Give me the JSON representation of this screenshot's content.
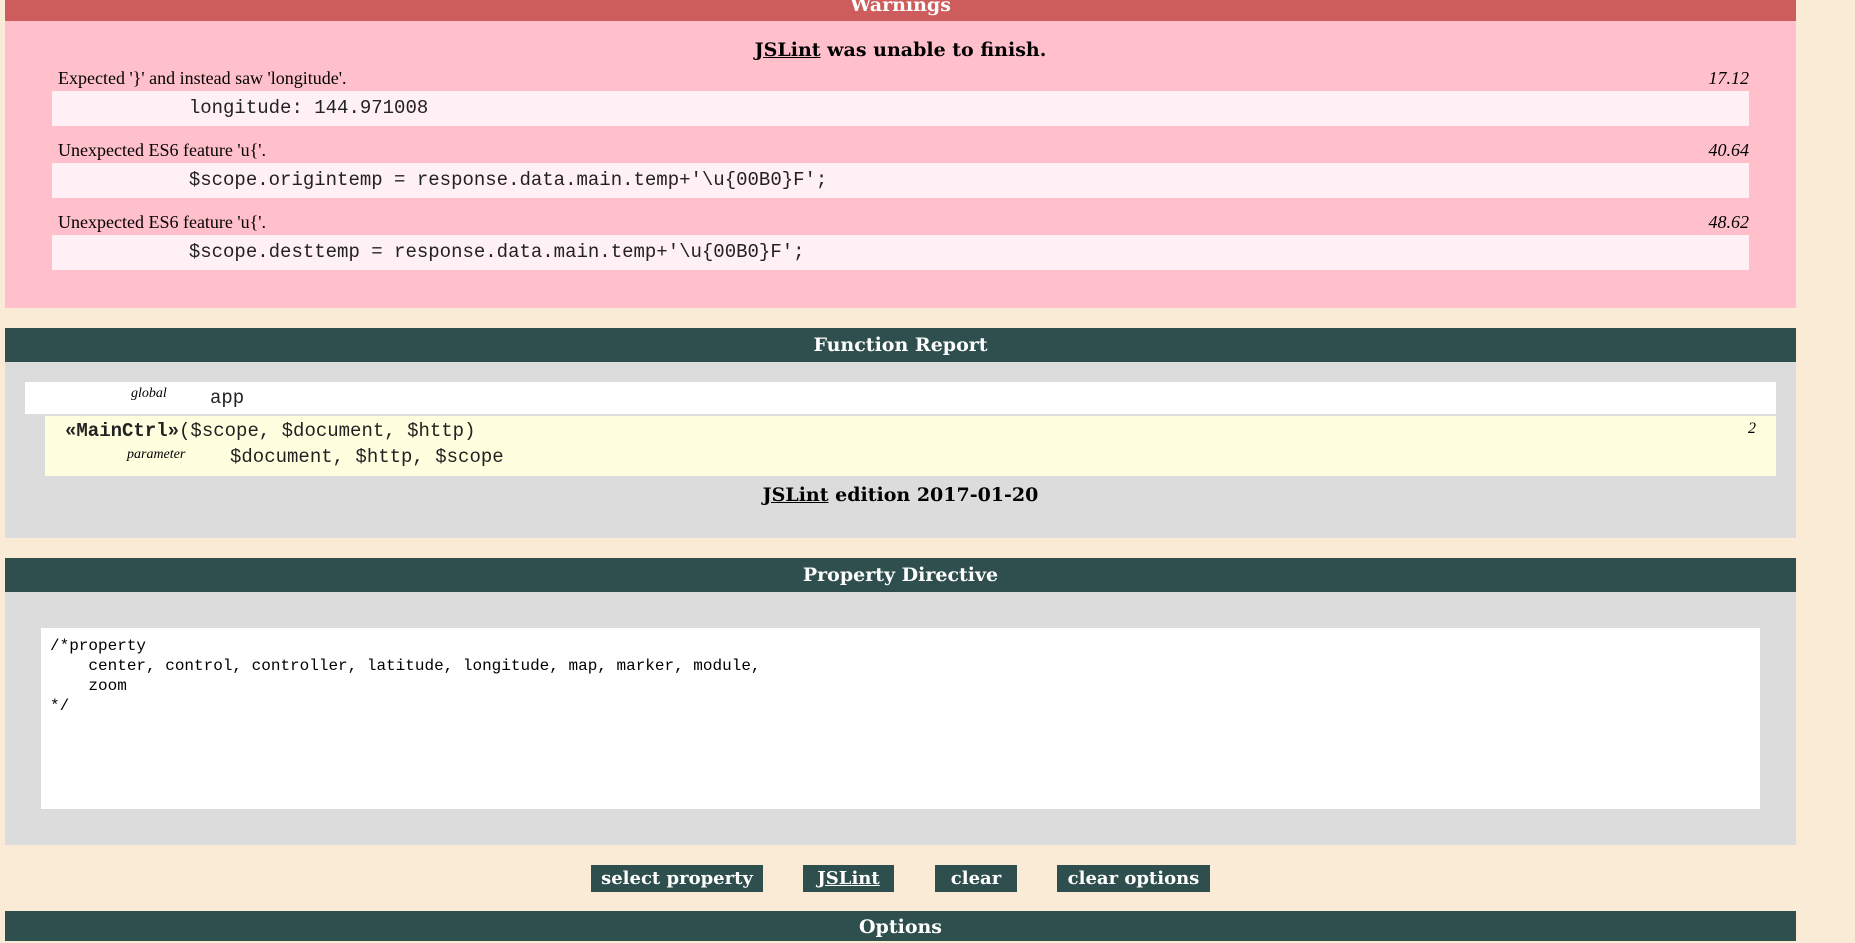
{
  "warnings": {
    "header": "Warnings",
    "title_link": "JSLint",
    "title_rest": " was unable to finish.",
    "items": [
      {
        "message": "Expected '}' and instead saw 'longitude'.",
        "position": "17.12",
        "code": "            longitude: 144.971008"
      },
      {
        "message": "Unexpected ES6 feature 'u{'.",
        "position": "40.64",
        "code": "            $scope.origintemp = response.data.main.temp+'\\u{00B0}F';"
      },
      {
        "message": "Unexpected ES6 feature 'u{'.",
        "position": "48.62",
        "code": "            $scope.desttemp = response.data.main.temp+'\\u{00B0}F';"
      }
    ]
  },
  "function_report": {
    "header": "Function Report",
    "global_label": "global",
    "global_value": "app",
    "function_name": "«MainCtrl»",
    "function_params": "($scope, $document, $http)",
    "function_line": "2",
    "parameter_label": "parameter",
    "parameter_value": "$document, $http, $scope",
    "edition_link": "JSLint",
    "edition_rest": " edition 2017-01-20"
  },
  "property_directive": {
    "header": "Property Directive",
    "text": "/*property\n    center, control, controller, latitude, longitude, map, marker, module,\n    zoom\n*/"
  },
  "buttons": {
    "select_property": "select property",
    "jslint": "JSLint",
    "clear": "clear",
    "clear_options": "clear options"
  },
  "options": {
    "header": "Options"
  },
  "colors": {
    "warning_bar": "#cd5c5c",
    "warning_bg": "#ffc0cb",
    "dark_bar": "#2f4f4f",
    "panel_bg": "#dcdcdc",
    "page_bg": "#faebd7"
  }
}
